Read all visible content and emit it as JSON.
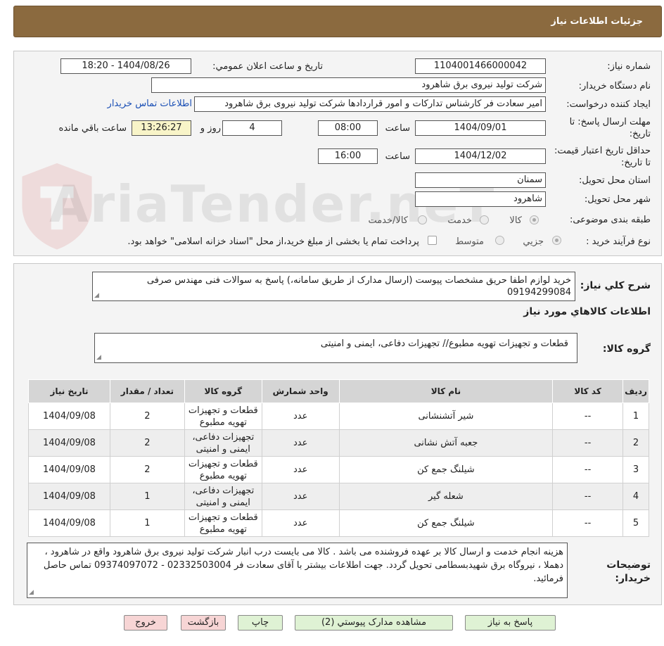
{
  "header": {
    "title": "جزئیات اطلاعات نیاز"
  },
  "form": {
    "need_number_label": "شماره نیاز:",
    "need_number": "1104001466000042",
    "announce_label": "تاریخ و ساعت اعلان عمومي:",
    "announce_value": "1404/08/26 - 18:20",
    "buyer_org_label": "نام دستگاه خریدار:",
    "buyer_org": "شرکت تولید نیروی برق شاهرود",
    "requester_label": "ایجاد کننده درخواست:",
    "requester": "امیر سعادت فر کارشناس تدارکات و امور قراردادها شرکت تولید نیروی برق شاهرود",
    "contact_link": "اطلاعات تماس خریدار",
    "reply_deadline_label": "مهلت ارسال پاسخ: تا تاریخ:",
    "reply_date": "1404/09/01",
    "time_label": "ساعت",
    "reply_time": "08:00",
    "days_value": "4",
    "days_label": "روز و",
    "remaining_time": "13:26:27",
    "remaining_label": "ساعت باقي مانده",
    "validity_label": "حداقل تاریخ اعتبار قیمت: تا تاریخ:",
    "validity_date": "1404/12/02",
    "validity_time": "16:00",
    "province_label": "استان محل تحویل:",
    "province": "سمنان",
    "city_label": "شهر محل تحویل:",
    "city": "شاهرود",
    "category_label": "طبقه بندی موضوعی:",
    "category_options": [
      "کالا",
      "خدمت",
      "کالا/خدمت"
    ],
    "purchase_type_label": "نوع فرآیند خرید :",
    "purchase_type_options": [
      "جزیي",
      "متوسط"
    ],
    "payment_note": "پرداخت تمام یا بخشی از مبلغ خرید،از محل \"اسناد خزانه اسلامی\" خواهد بود."
  },
  "watermark": {
    "text": "AriaTender.neT"
  },
  "summary": {
    "label": "شرح كلي نياز:",
    "text": "خرید لوازم اطفا حریق مشخصات پیوست (ارسال مدارک از طریق سامانه،) پاسخ به سوالات فنی مهندس صرفی 09194299084"
  },
  "goods_section": {
    "title": "اطلاعات کالاهاي مورد نياز",
    "group_label": "گروه کالا:",
    "group_value": "قطعات و تجهیزات تهویه مطبوع// تجهیزات دفاعی، ایمنی و امنیتی"
  },
  "table": {
    "headers": [
      "رديف",
      "کد کالا",
      "نام کالا",
      "واحد شمارش",
      "گروه کالا",
      "تعداد / مقدار",
      "تاریخ نیاز"
    ],
    "rows": [
      [
        "1",
        "--",
        "شیر آتشنشانی",
        "عدد",
        "قطعات و تجهیزات تهویه مطبوع",
        "2",
        "1404/09/08"
      ],
      [
        "2",
        "--",
        "جعبه آتش نشانی",
        "عدد",
        "تجهیزات دفاعی، ایمنی و امنیتی",
        "2",
        "1404/09/08"
      ],
      [
        "3",
        "--",
        "شیلنگ جمع کن",
        "عدد",
        "قطعات و تجهیزات تهویه مطبوع",
        "2",
        "1404/09/08"
      ],
      [
        "4",
        "--",
        "شعله گیر",
        "عدد",
        "تجهیزات دفاعی، ایمنی و امنیتی",
        "1",
        "1404/09/08"
      ],
      [
        "5",
        "--",
        "شیلنگ جمع کن",
        "عدد",
        "قطعات و تجهیزات تهویه مطبوع",
        "1",
        "1404/09/08"
      ]
    ]
  },
  "buyer_notes": {
    "label": "توضیحات خریدار:",
    "text": "هزینه انجام خدمت و ارسال کالا بر عهده فروشنده می باشد . کالا می بایست درب انبار شرکت تولید نیروی برق شاهرود واقع در شاهرود ، دهملا ، نیروگاه برق شهیدبسطامی تحویل گردد. جهت اطلاعات بیشتر با آقای سعادت فر 02332503004 - 09374097072 تماس حاصل فرمائید."
  },
  "buttons": {
    "reply": "پاسخ به نیاز",
    "attachments": "مشاهده مدارک پیوستي (2)",
    "print": "چاپ",
    "back": "بازگشت",
    "exit": "خروج"
  }
}
